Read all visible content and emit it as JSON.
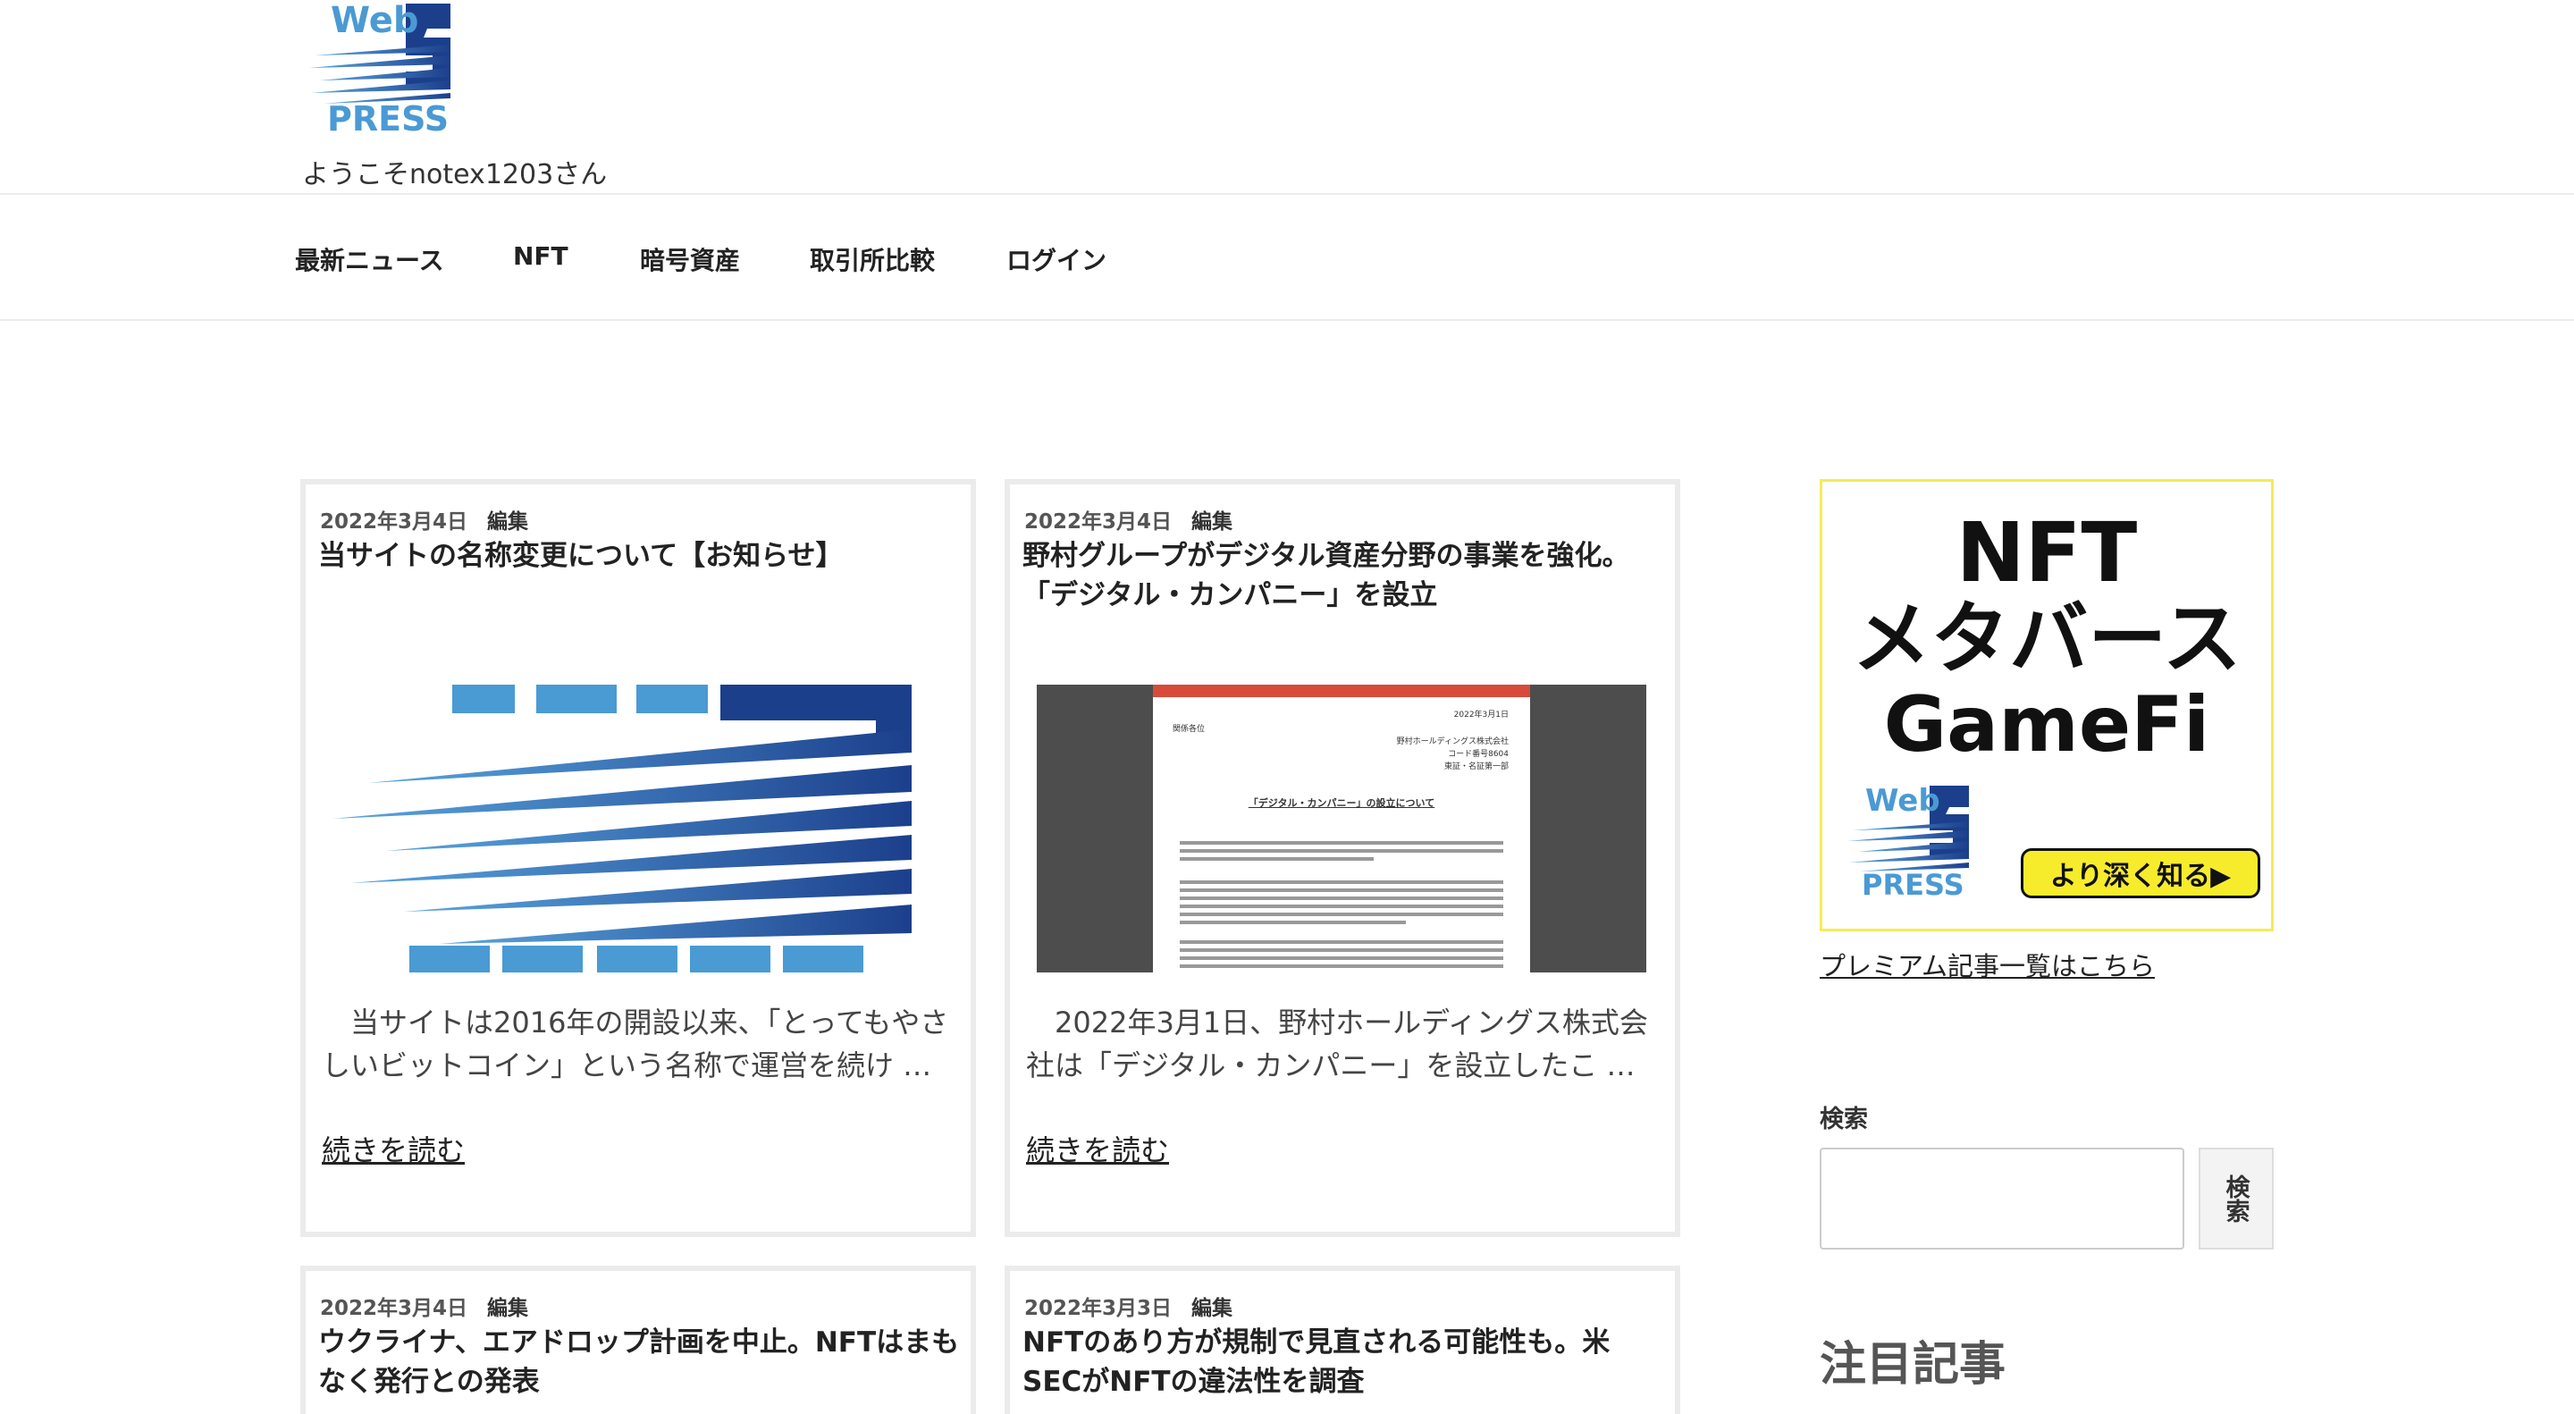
{
  "header": {
    "logo_top": "Web",
    "logo_num": "3",
    "logo_bottom": "PRESS",
    "welcome": "ようこそnotex1203さん"
  },
  "nav": {
    "items": [
      {
        "label": "最新ニュース"
      },
      {
        "label": "NFT"
      },
      {
        "label": "暗号資産"
      },
      {
        "label": "取引所比較"
      },
      {
        "label": "ログイン"
      }
    ]
  },
  "posts": [
    {
      "date": "2022年3月4日",
      "author": "編集",
      "title": "当サイトの名称変更について【お知らせ】",
      "excerpt": "当サイトは2016年の開設以来、「とってもやさしいビットコイン」という名称で運営を続け …",
      "more": "続きを読む"
    },
    {
      "date": "2022年3月4日",
      "author": "編集",
      "title": "野村グループがデジタル資産分野の事業を強化。「デジタル・カンパニー」を設立",
      "excerpt": "2022年3月1日、野村ホールディングス株式会社は「デジタル・カンパニー」を設立したこ …",
      "more": "続きを読む"
    },
    {
      "date": "2022年3月4日",
      "author": "編集",
      "title": "ウクライナ、エアドロップ計画を中止。NFTはまもなく発行との発表"
    },
    {
      "date": "2022年3月3日",
      "author": "編集",
      "title": "NFTのあり方が規制で見直される可能性も。米SECがNFTの違法性を調査"
    }
  ],
  "press_doc": {
    "date": "2022年3月1日",
    "to": "関係各位",
    "company": "野村ホールディングス株式会社",
    "code": "コード番号8604",
    "exchange": "東証・名証第一部",
    "heading": "「デジタル・カンパニー」の設立について"
  },
  "sidebar": {
    "ad": {
      "line1": "NFT",
      "line2": "メタバース",
      "line3": "GameFi",
      "cta": "より深く知る▶"
    },
    "premium_link": "プレミアム記事一覧はこちら",
    "search_label": "検索",
    "search_button": "検索",
    "featured_heading": "注目記事"
  },
  "colors": {
    "logo_light_blue": "#4a9ad4",
    "logo_dark_blue": "#1c3f8c",
    "ad_yellow": "#f7ec2c",
    "card_border": "#ebebeb",
    "press_red": "#d84a3a"
  }
}
